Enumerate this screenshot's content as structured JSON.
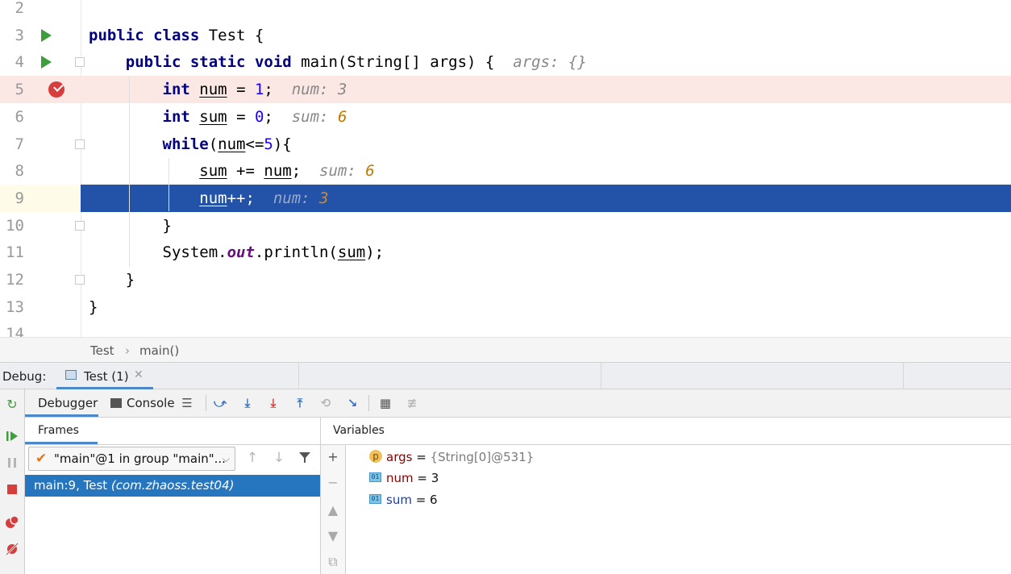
{
  "editor": {
    "lines": [
      {
        "no": "2",
        "segs": []
      },
      {
        "no": "3",
        "segs": [
          [
            "kw",
            "public"
          ],
          [
            "t",
            " "
          ],
          [
            "kw",
            "class"
          ],
          [
            "t",
            " Test {"
          ]
        ]
      },
      {
        "no": "4",
        "segs": [
          [
            "t",
            "    "
          ],
          [
            "kw",
            "public"
          ],
          [
            "t",
            " "
          ],
          [
            "kw",
            "static"
          ],
          [
            "t",
            " "
          ],
          [
            "kw",
            "void"
          ],
          [
            "t",
            " main(String[] args) {  "
          ],
          [
            "hint",
            "args: {}"
          ]
        ]
      },
      {
        "no": "5",
        "segs": [
          [
            "t",
            "        "
          ],
          [
            "kw",
            "int"
          ],
          [
            "t",
            " "
          ],
          [
            "u",
            "num"
          ],
          [
            "t",
            " = "
          ],
          [
            "num",
            "1"
          ],
          [
            "t",
            ";  "
          ],
          [
            "hint",
            "num: 3"
          ]
        ]
      },
      {
        "no": "6",
        "segs": [
          [
            "t",
            "        "
          ],
          [
            "kw",
            "int"
          ],
          [
            "t",
            " "
          ],
          [
            "u",
            "sum"
          ],
          [
            "t",
            " = "
          ],
          [
            "num",
            "0"
          ],
          [
            "t",
            ";  "
          ],
          [
            "hint",
            "sum: "
          ],
          [
            "hintv",
            "6"
          ]
        ]
      },
      {
        "no": "7",
        "segs": [
          [
            "t",
            "        "
          ],
          [
            "kw",
            "while"
          ],
          [
            "t",
            "("
          ],
          [
            "u",
            "num"
          ],
          [
            "t",
            "<="
          ],
          [
            "num",
            "5"
          ],
          [
            "t",
            "){"
          ]
        ]
      },
      {
        "no": "8",
        "segs": [
          [
            "t",
            "            "
          ],
          [
            "u",
            "sum"
          ],
          [
            "t",
            " += "
          ],
          [
            "u",
            "num"
          ],
          [
            "t",
            ";  "
          ],
          [
            "hint",
            "sum: "
          ],
          [
            "hintv",
            "6"
          ]
        ]
      },
      {
        "no": "9",
        "segs": [
          [
            "t",
            "            "
          ],
          [
            "u",
            "num"
          ],
          [
            "t",
            "++;  "
          ],
          [
            "hint",
            "num: "
          ],
          [
            "hintv",
            "3"
          ]
        ]
      },
      {
        "no": "10",
        "segs": [
          [
            "t",
            "        }"
          ]
        ]
      },
      {
        "no": "11",
        "segs": [
          [
            "t",
            "        System."
          ],
          [
            "it",
            "out"
          ],
          [
            "t",
            ".println("
          ],
          [
            "u",
            "sum"
          ],
          [
            "t",
            ");"
          ]
        ]
      },
      {
        "no": "12",
        "segs": [
          [
            "t",
            "    }"
          ]
        ]
      },
      {
        "no": "13",
        "segs": [
          [
            "t",
            "}"
          ]
        ]
      },
      {
        "no": "14",
        "segs": []
      }
    ]
  },
  "breadcrumb": {
    "class": "Test",
    "sep": "›",
    "method": "main()"
  },
  "debug": {
    "label": "Debug:",
    "session_tab": "Test (1)",
    "close": "✕",
    "tabs": {
      "debugger": "Debugger",
      "console": "Console"
    },
    "frames_title": "Frames",
    "thread": "\"main\"@1 in group \"main\"...",
    "frame": {
      "location": "main:9, Test ",
      "package": "(com.zhaoss.test04)"
    },
    "variables_title": "Variables",
    "variables": [
      {
        "name": "args",
        "eq": " = ",
        "value": "{String[0]@531}",
        "icon": "p"
      },
      {
        "name": "num",
        "eq": " = ",
        "value": "3",
        "icon": "01"
      },
      {
        "name": "sum",
        "eq": " = ",
        "value": "6",
        "icon": "01"
      }
    ]
  },
  "colors": {
    "current_line": "#2253a9",
    "breakpoint_line": "#fbe7e3",
    "frame_selected": "#2675bf",
    "accent": "#4a88c7"
  }
}
